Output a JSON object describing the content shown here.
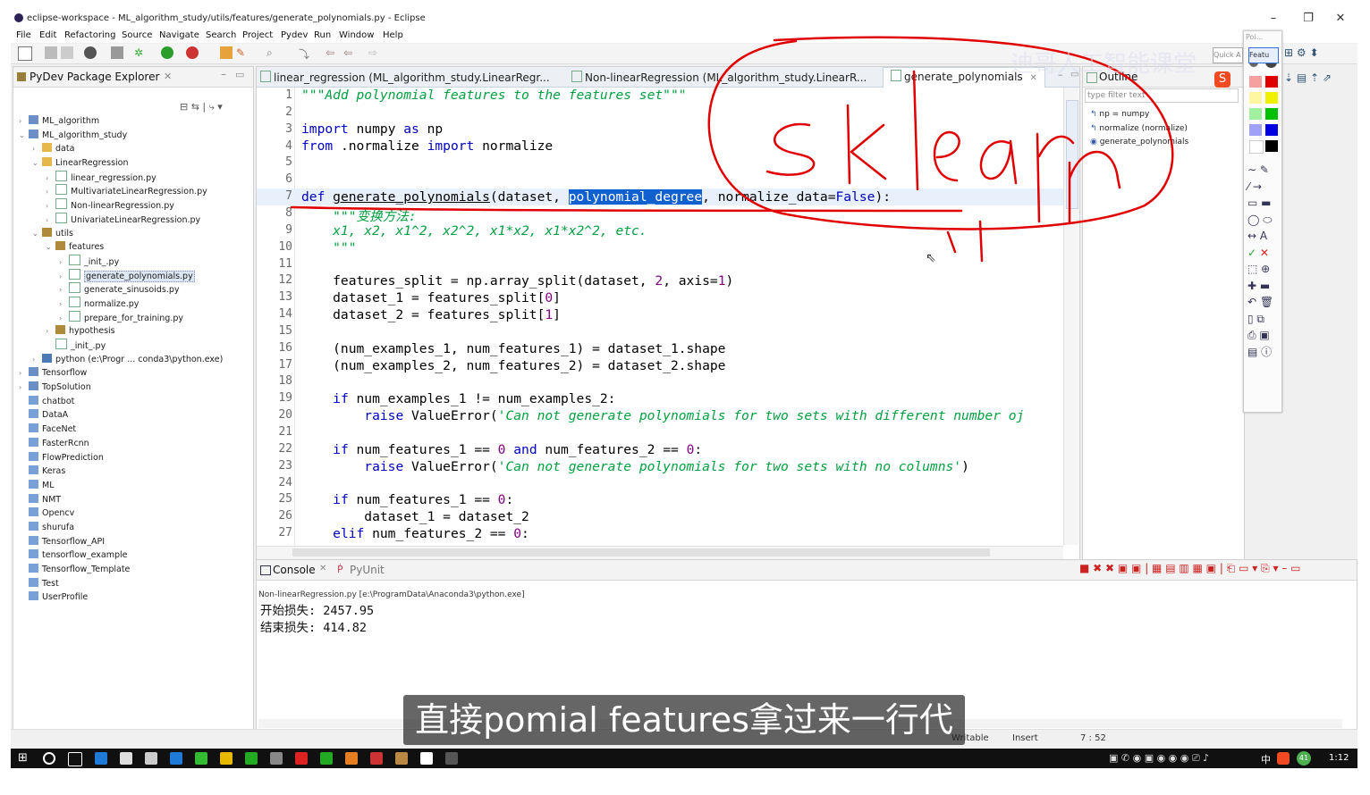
{
  "window": {
    "title": "eclipse-workspace - ML_algorithm_study/utils/features/generate_polynomials.py - Eclipse",
    "minimize": "–",
    "maximize": "❐",
    "close": "✕"
  },
  "menu": [
    "File",
    "Edit",
    "Refactoring",
    "Source",
    "Navigate",
    "Search",
    "Project",
    "Pydev",
    "Run",
    "Window",
    "Help"
  ],
  "package_explorer": {
    "title": "PyDev Package Explorer",
    "tree": [
      {
        "indent": 0,
        "twisty": "›",
        "label": "ML_algorithm",
        "icon": "project-icon"
      },
      {
        "indent": 0,
        "twisty": "⌄",
        "label": "ML_algorithm_study",
        "icon": "project-icon"
      },
      {
        "indent": 1,
        "twisty": "›",
        "label": "data",
        "icon": "folder-icon"
      },
      {
        "indent": 1,
        "twisty": "⌄",
        "label": "LinearRegression",
        "icon": "folder-icon"
      },
      {
        "indent": 2,
        "twisty": "›",
        "label": "linear_regression.py",
        "icon": "py-file-icon"
      },
      {
        "indent": 2,
        "twisty": "›",
        "label": "MultivariateLinearRegression.py",
        "icon": "py-file-icon"
      },
      {
        "indent": 2,
        "twisty": "›",
        "label": "Non-linearRegression.py",
        "icon": "py-file-icon"
      },
      {
        "indent": 2,
        "twisty": "›",
        "label": "UnivariateLinearRegression.py",
        "icon": "py-file-icon"
      },
      {
        "indent": 1,
        "twisty": "⌄",
        "label": "utils",
        "icon": "package-icon"
      },
      {
        "indent": 2,
        "twisty": "⌄",
        "label": "features",
        "icon": "package-icon"
      },
      {
        "indent": 3,
        "twisty": "›",
        "label": "_init_.py",
        "icon": "py-file-icon"
      },
      {
        "indent": 3,
        "twisty": "›",
        "label": "generate_polynomials.py",
        "icon": "py-file-icon",
        "selected": true
      },
      {
        "indent": 3,
        "twisty": "›",
        "label": "generate_sinusoids.py",
        "icon": "py-file-icon"
      },
      {
        "indent": 3,
        "twisty": "›",
        "label": "normalize.py",
        "icon": "py-file-icon"
      },
      {
        "indent": 3,
        "twisty": "›",
        "label": "prepare_for_training.py",
        "icon": "py-file-icon"
      },
      {
        "indent": 2,
        "twisty": "›",
        "label": "hypothesis",
        "icon": "package-icon"
      },
      {
        "indent": 2,
        "twisty": "",
        "label": "_init_.py",
        "icon": "py-file-icon"
      },
      {
        "indent": 1,
        "twisty": "›",
        "label": "python  (e:\\Progr ... conda3\\python.exe)",
        "icon": "python-icon"
      },
      {
        "indent": 0,
        "twisty": "›",
        "label": "Tensorflow",
        "icon": "project-icon"
      },
      {
        "indent": 0,
        "twisty": "›",
        "label": "TopSolution",
        "icon": "project-icon"
      },
      {
        "indent": 0,
        "twisty": "",
        "label": "chatbot",
        "icon": "closed-project-icon"
      },
      {
        "indent": 0,
        "twisty": "",
        "label": "DataA",
        "icon": "closed-project-icon"
      },
      {
        "indent": 0,
        "twisty": "",
        "label": "FaceNet",
        "icon": "closed-project-icon"
      },
      {
        "indent": 0,
        "twisty": "",
        "label": "FasterRcnn",
        "icon": "closed-project-icon"
      },
      {
        "indent": 0,
        "twisty": "",
        "label": "FlowPrediction",
        "icon": "closed-project-icon"
      },
      {
        "indent": 0,
        "twisty": "",
        "label": "Keras",
        "icon": "closed-project-icon"
      },
      {
        "indent": 0,
        "twisty": "",
        "label": "ML",
        "icon": "closed-project-icon"
      },
      {
        "indent": 0,
        "twisty": "",
        "label": "NMT",
        "icon": "closed-project-icon"
      },
      {
        "indent": 0,
        "twisty": "",
        "label": "Opencv",
        "icon": "closed-project-icon"
      },
      {
        "indent": 0,
        "twisty": "",
        "label": "shurufa",
        "icon": "closed-project-icon"
      },
      {
        "indent": 0,
        "twisty": "",
        "label": "Tensorflow_API",
        "icon": "closed-project-icon"
      },
      {
        "indent": 0,
        "twisty": "",
        "label": "tensorflow_example",
        "icon": "closed-project-icon"
      },
      {
        "indent": 0,
        "twisty": "",
        "label": "Tensorflow_Template",
        "icon": "closed-project-icon"
      },
      {
        "indent": 0,
        "twisty": "",
        "label": "Test",
        "icon": "closed-project-icon"
      },
      {
        "indent": 0,
        "twisty": "",
        "label": "UserProfile",
        "icon": "closed-project-icon"
      }
    ]
  },
  "editor_tabs": [
    {
      "label": "linear_regression (ML_algorithm_study.LinearRegr..."
    },
    {
      "label": "Non-linearRegression (ML_algorithm_study.LinearR..."
    },
    {
      "label": "generate_polynomials",
      "active": true
    }
  ],
  "code_lines": [
    "1",
    "2",
    "3",
    "4",
    "5",
    "6",
    "7",
    "8",
    "9",
    "10",
    "11",
    "12",
    "13",
    "14",
    "15",
    "16",
    "17",
    "18",
    "19",
    "20",
    "21",
    "22",
    "23",
    "24",
    "25",
    "26",
    "27"
  ],
  "code": {
    "l1": "\"\"\"Add polynomial features to the features set\"\"\"",
    "l3a": "import",
    "l3b": " numpy ",
    "l3c": "as",
    "l3d": " np",
    "l4a": "from",
    "l4b": " .normalize ",
    "l4c": "import",
    "l4d": " normalize",
    "l7a": "def",
    "l7b": "generate_polynomials",
    "l7c": "(dataset, ",
    "l7d": "polynomial_degree",
    "l7e": ", normalize_data=",
    "l7f": "False",
    "l7g": "):",
    "l8": "    \"\"\"变换方法:",
    "l9": "    x1, x2, x1^2, x2^2, x1*x2, x1*x2^2, etc.",
    "l10": "    \"\"\"",
    "l12a": "    features_split = np.array_split(dataset, ",
    "l12b": "2",
    "l12c": ", axis=",
    "l12d": "1",
    "l12e": ")",
    "l13a": "    dataset_1 = features_split[",
    "l13b": "0",
    "l13c": "]",
    "l14a": "    dataset_2 = features_split[",
    "l14b": "1",
    "l14c": "]",
    "l16": "    (num_examples_1, num_features_1) = dataset_1.shape",
    "l17": "    (num_examples_2, num_features_2) = dataset_2.shape",
    "l19a": "    ",
    "l19b": "if",
    "l19c": " num_examples_1 != num_examples_2:",
    "l20a": "        ",
    "l20b": "raise",
    "l20c": " ValueError(",
    "l20d": "'Can not generate polynomials for two sets with different number oj",
    "l22a": "    ",
    "l22b": "if",
    "l22c": " num_features_1 == ",
    "l22d": "0",
    "l22e": " and",
    "l22f": " num_features_2 == ",
    "l22g": "0",
    "l22h": ":",
    "l23a": "        ",
    "l23b": "raise",
    "l23c": " ValueError(",
    "l23d": "'Can not generate polynomials for two sets with no columns'",
    "l23e": ")",
    "l25a": "    ",
    "l25b": "if",
    "l25c": " num_features_1 == ",
    "l25d": "0",
    "l25e": ":",
    "l26": "        dataset_1 = dataset_2",
    "l27a": "    ",
    "l27b": "elif",
    "l27c": " num_features_2 == ",
    "l27d": "0",
    "l27e": ":"
  },
  "outline": {
    "title": "Outline",
    "filter_placeholder": "type filter text",
    "items": [
      "np = numpy",
      "normalize (normalize)",
      "generate_polynomials"
    ]
  },
  "palette": {
    "top_label": "Poi...",
    "quick": "Quick A",
    "feature": "Featu"
  },
  "console": {
    "tabs": [
      "Console",
      "PyUnit"
    ],
    "process": "Non-linearRegression.py [e:\\ProgramData\\Anaconda3\\python.exe]",
    "lines": [
      "开始损失:  2457.95",
      "结束损失:  414.82"
    ]
  },
  "status": {
    "writable": "Writable",
    "insert": "Insert",
    "position": "7 : 52"
  },
  "overlay": {
    "subtitle": "直接pomial features拿过来一行代码",
    "annotation_text": "sklearn",
    "watermark": "迪哥人工智能课堂"
  },
  "taskbar": {
    "clock": "1:12",
    "ime": "中",
    "badge": "41"
  }
}
